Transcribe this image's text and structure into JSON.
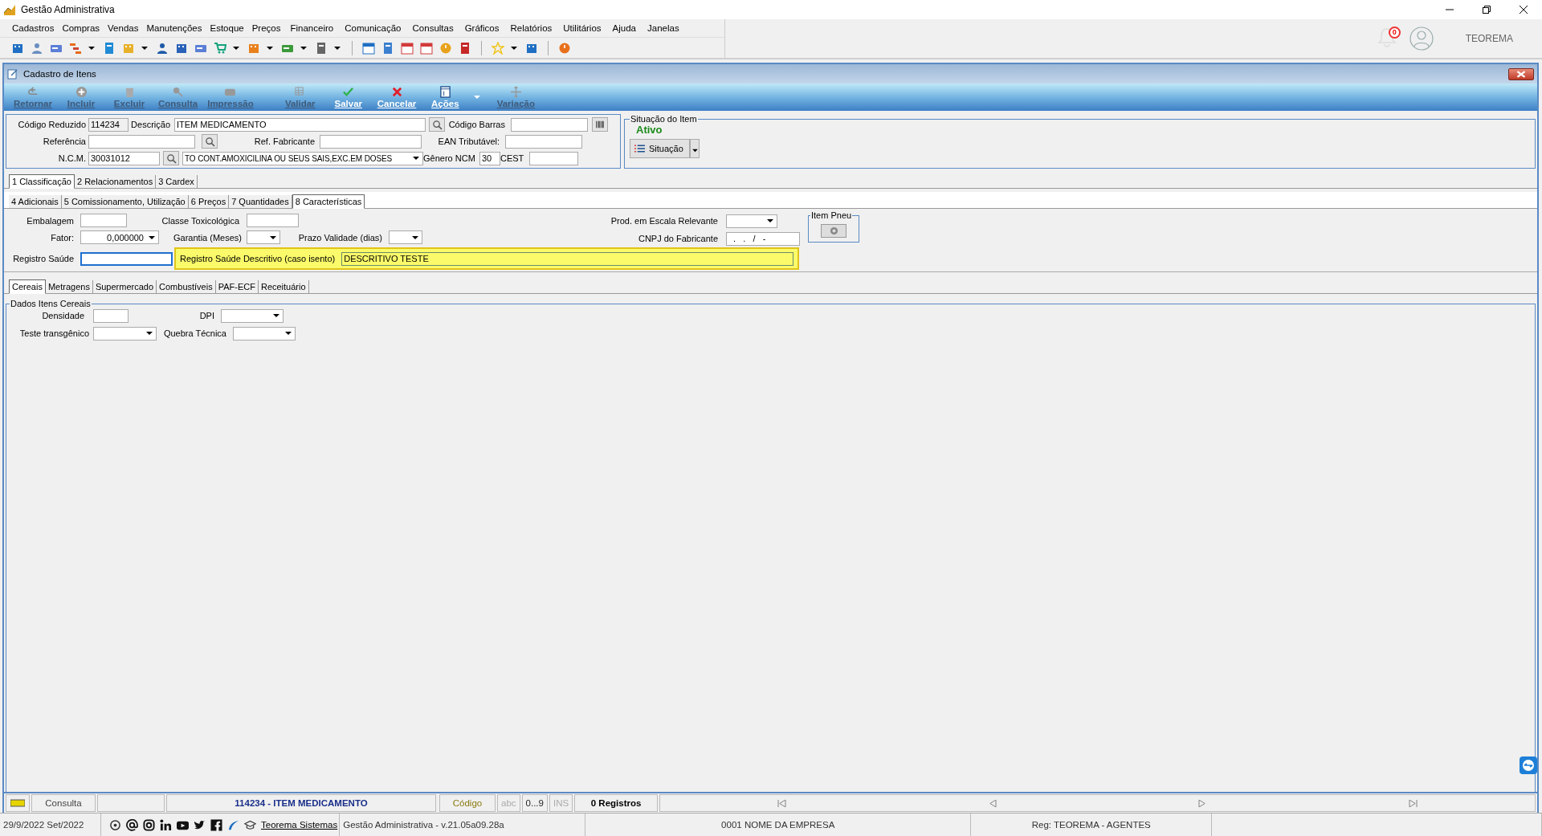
{
  "app": {
    "title": "Gestão Administrativa",
    "notification_count": "0",
    "user": "TEOREMA"
  },
  "menu": [
    "Cadastros",
    "Compras",
    "Vendas",
    "Manutenções",
    "Estoque",
    "Preços",
    "Financeiro",
    "Comunicação",
    "Consultas",
    "Gráficos",
    "Relatórios",
    "Utilitários",
    "Ajuda",
    "Janelas"
  ],
  "form": {
    "title": "Cadastro de Itens"
  },
  "actions": [
    [
      {
        "label": "Retornar",
        "kind": "back",
        "disabled": true
      },
      {
        "label": "Incluir",
        "kind": "add",
        "disabled": true
      },
      {
        "label": "Excluir",
        "kind": "trash",
        "disabled": true
      },
      {
        "label": "Consulta",
        "kind": "search",
        "disabled": true
      },
      {
        "label": "Impressão",
        "kind": "print",
        "disabled": true
      }
    ],
    [
      {
        "label": "Validar",
        "kind": "grid",
        "disabled": true
      },
      {
        "label": "Salvar",
        "kind": "check",
        "disabled": false
      },
      {
        "label": "Cancelar",
        "kind": "cross",
        "disabled": false
      },
      {
        "label": "Ações",
        "kind": "window",
        "disabled": false,
        "menu": true
      },
      {
        "label": "Variação",
        "kind": "move",
        "disabled": true
      }
    ]
  ],
  "item": {
    "codigo_reduzido": {
      "label": "Código Reduzido",
      "value": "114234"
    },
    "descricao": {
      "label": "Descrição",
      "value": "ITEM MEDICAMENTO"
    },
    "codigo_barras": {
      "label": "Código Barras"
    },
    "referencia": {
      "label": "Referência"
    },
    "ref_fabricante": {
      "label": "Ref. Fabricante"
    },
    "ean_tributavel": {
      "label": "EAN Tributável:"
    },
    "ncm": {
      "label": "N.C.M.",
      "value": "30031012"
    },
    "ncm_descricao": {
      "value": "TO CONT.AMOXICILINA OU SEUS SAIS,EXC.EM DOSES"
    },
    "genero_ncm": {
      "label": "Gênero NCM",
      "value": "30"
    },
    "cest": {
      "label": "CEST"
    }
  },
  "situacao": {
    "title": "Situação do Item",
    "status": "Ativo",
    "button": "Situação"
  },
  "main_tabs": [
    {
      "label": "1 Classificação",
      "selected": true
    },
    {
      "label": "2 Relacionamentos",
      "selected": false
    },
    {
      "label": "3 Cardex",
      "selected": false
    }
  ],
  "sub_tabs": [
    {
      "label": "4 Adicionais",
      "selected": false
    },
    {
      "label": "5 Comissionamento, Utilização",
      "selected": false
    },
    {
      "label": "6 Preços",
      "selected": false
    },
    {
      "label": "7 Quantidades",
      "selected": false
    },
    {
      "label": "8 Características",
      "selected": true
    }
  ],
  "caracteristicas": {
    "embalagem": {
      "label": "Embalagem"
    },
    "classe_toxicologica": {
      "label": "Classe Toxicológica"
    },
    "prod_escala": {
      "label": "Prod. em Escala Relevante"
    },
    "item_pneu": {
      "title": "Item Pneu"
    },
    "fator": {
      "label": "Fator:",
      "value": "0,000000"
    },
    "garantia": {
      "label": "Garantia (Meses)"
    },
    "prazo_validade": {
      "label": "Prazo Validade (dias)"
    },
    "cnpj_fabricante": {
      "label": "CNPJ do Fabricante",
      "value": "  .   .   /   -"
    },
    "registro_saude": {
      "label": "Registro Saúde",
      "focused": true
    },
    "registro_saude_descritivo": {
      "label": "Registro Saúde Descritivo (caso isento)",
      "value": "DESCRITIVO TESTE",
      "highlighted": true
    }
  },
  "bottom_tabs": [
    {
      "label": "Cereais",
      "selected": true
    },
    {
      "label": "Metragens",
      "selected": false
    },
    {
      "label": "Supermercado",
      "selected": false
    },
    {
      "label": "Combustíveis",
      "selected": false
    },
    {
      "label": "PAF-ECF",
      "selected": false
    },
    {
      "label": "Receituário",
      "selected": false
    }
  ],
  "cereais": {
    "title": "Dados Itens Cereais",
    "densidade": {
      "label": "Densidade"
    },
    "dpi": {
      "label": "DPI"
    },
    "teste_transgenico": {
      "label": "Teste transgênico"
    },
    "quebra_tecnica": {
      "label": "Quebra Técnica"
    }
  },
  "status_bar": {
    "mode": "Consulta",
    "record": "114234 - ITEM MEDICAMENTO",
    "key": "Código",
    "indicators": [
      {
        "label": "abc",
        "on": false
      },
      {
        "label": "0...9",
        "on": true
      },
      {
        "label": "INS",
        "on": false
      }
    ],
    "count": "0 Registros"
  },
  "footer": {
    "date": "29/9/2022 Set/2022",
    "link": "Teorema Sistemas",
    "version": "Gestão Administrativa - v.21.05a09.28a",
    "company": "0001 NOME DA EMPRESA",
    "registration": "Reg: TEOREMA - AGENTES"
  }
}
